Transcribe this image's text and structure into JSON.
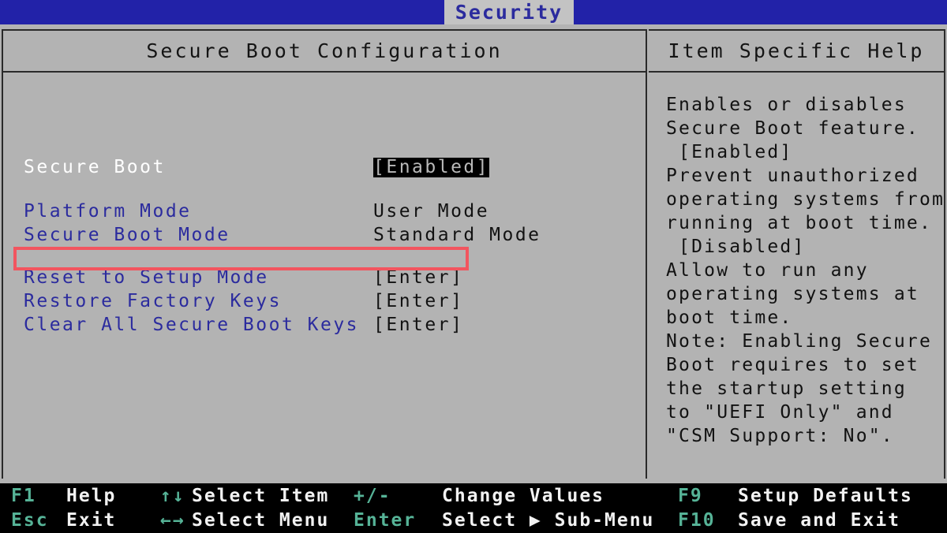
{
  "tabs": {
    "active_label": "Security"
  },
  "left_panel": {
    "title": "Secure Boot Configuration",
    "rows": [
      {
        "label": "Secure Boot",
        "value": "[Enabled]",
        "label_style": "white",
        "value_style": "inverse"
      },
      {
        "label": "Platform Mode",
        "value": "User Mode",
        "label_style": "blue",
        "value_style": "black"
      },
      {
        "label": "Secure Boot Mode",
        "value": "Standard Mode",
        "label_style": "blue",
        "value_style": "black"
      },
      {
        "label": "Reset to Setup Mode",
        "value": "[Enter]",
        "label_style": "blue",
        "value_style": "black"
      },
      {
        "label": "Restore Factory Keys",
        "value": "[Enter]",
        "label_style": "blue",
        "value_style": "black"
      },
      {
        "label": "Clear All Secure Boot Keys",
        "value": "[Enter]",
        "label_style": "blue",
        "value_style": "black"
      }
    ],
    "highlight": {
      "target_label": "Restore Factory Keys",
      "color": "#f2555f"
    }
  },
  "help_panel": {
    "title": "Item Specific Help",
    "lines": [
      "Enables or disables",
      "Secure Boot feature.",
      " [Enabled]",
      "Prevent unauthorized",
      "operating systems from",
      "running at boot time.",
      " [Disabled]",
      "Allow to run any",
      "operating systems at",
      "boot time.",
      "Note: Enabling Secure",
      "Boot requires to set",
      "the startup setting",
      "to \"UEFI Only\" and",
      "\"CSM Support: No\"."
    ]
  },
  "key_bar": {
    "row1": [
      {
        "key": "F1",
        "desc": "Help"
      },
      {
        "key": "↑↓",
        "desc": "Select Item"
      },
      {
        "key": "+/-",
        "desc": "Change Values"
      },
      {
        "key": "F9",
        "desc": "Setup Defaults"
      }
    ],
    "row2": [
      {
        "key": "Esc",
        "desc": "Exit"
      },
      {
        "key": "←→",
        "desc": "Select Menu"
      },
      {
        "key": "Enter",
        "desc": "Select ▶ Sub-Menu"
      },
      {
        "key": "F10",
        "desc": "Save and Exit"
      }
    ]
  },
  "colors": {
    "tab_blue": "#2222a8",
    "panel_gray": "#b3b3b3",
    "label_blue": "#2b2b9e",
    "key_teal": "#56b397",
    "highlight_red": "#f2555f"
  }
}
